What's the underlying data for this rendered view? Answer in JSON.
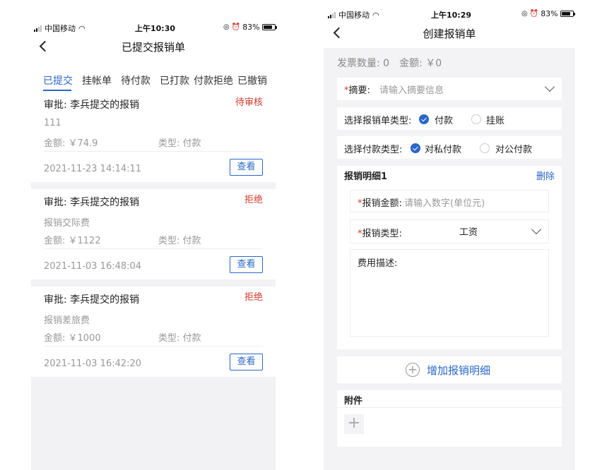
{
  "status_left": {
    "carrier": "中国移动",
    "time": "上午10:30",
    "battery": "83%"
  },
  "status_right": {
    "carrier": "中国移动",
    "time": "上午10:29",
    "battery": "83%"
  },
  "submitted": {
    "title": "已提交报销单",
    "tabs": [
      "已提交",
      "挂帐单",
      "待付款",
      "已打款",
      "付款拒绝",
      "已撤销"
    ],
    "view_label": "查看",
    "items": [
      {
        "title": "审批: 李兵提交的报销",
        "status": "待审核",
        "status_color": "#d23a2a",
        "summary": "111",
        "amount": "金额: ￥74.9",
        "type": "类型: 付款",
        "date": "2021-11-23 14:14:11"
      },
      {
        "title": "审批: 李兵提交的报销",
        "status": "拒绝",
        "status_color": "#d23a2a",
        "summary": "报销交际费",
        "amount": "金额: ￥1122",
        "type": "类型: 付款",
        "date": "2021-11-03 16:48:04"
      },
      {
        "title": "审批: 李兵提交的报销",
        "status": "拒绝",
        "status_color": "#d23a2a",
        "summary": "报销差旅费",
        "amount": "金额: ￥1000",
        "type": "类型: 付款",
        "date": "2021-11-03 16:42:20"
      }
    ]
  },
  "create": {
    "title": "创建报销单",
    "summary_bar": "发票数量: 0　金额: ￥0",
    "abstract_label": "摘要:",
    "abstract_placeholder": "请输入摘要信息",
    "form_type_label": "选择报销单类型:",
    "form_type_options": [
      "付款",
      "挂账"
    ],
    "form_type_selected": "付款",
    "pay_type_label": "选择付款类型:",
    "pay_type_options": [
      "对私付款",
      "对公付款"
    ],
    "pay_type_selected": "对私付款",
    "detail_title": "报销明细1",
    "delete_label": "删除",
    "amount_label": "报销金额:",
    "amount_placeholder": "请输入数字(单位元)",
    "type_label": "报销类型:",
    "type_value": "工资",
    "desc_label": "费用描述:",
    "add_detail_label": "增加报销明细",
    "attachment_label": "附件",
    "add_symbol": "+",
    "required_mark": "*"
  },
  "colors": {
    "accent": "#2a67c9",
    "danger": "#d23a2a"
  }
}
